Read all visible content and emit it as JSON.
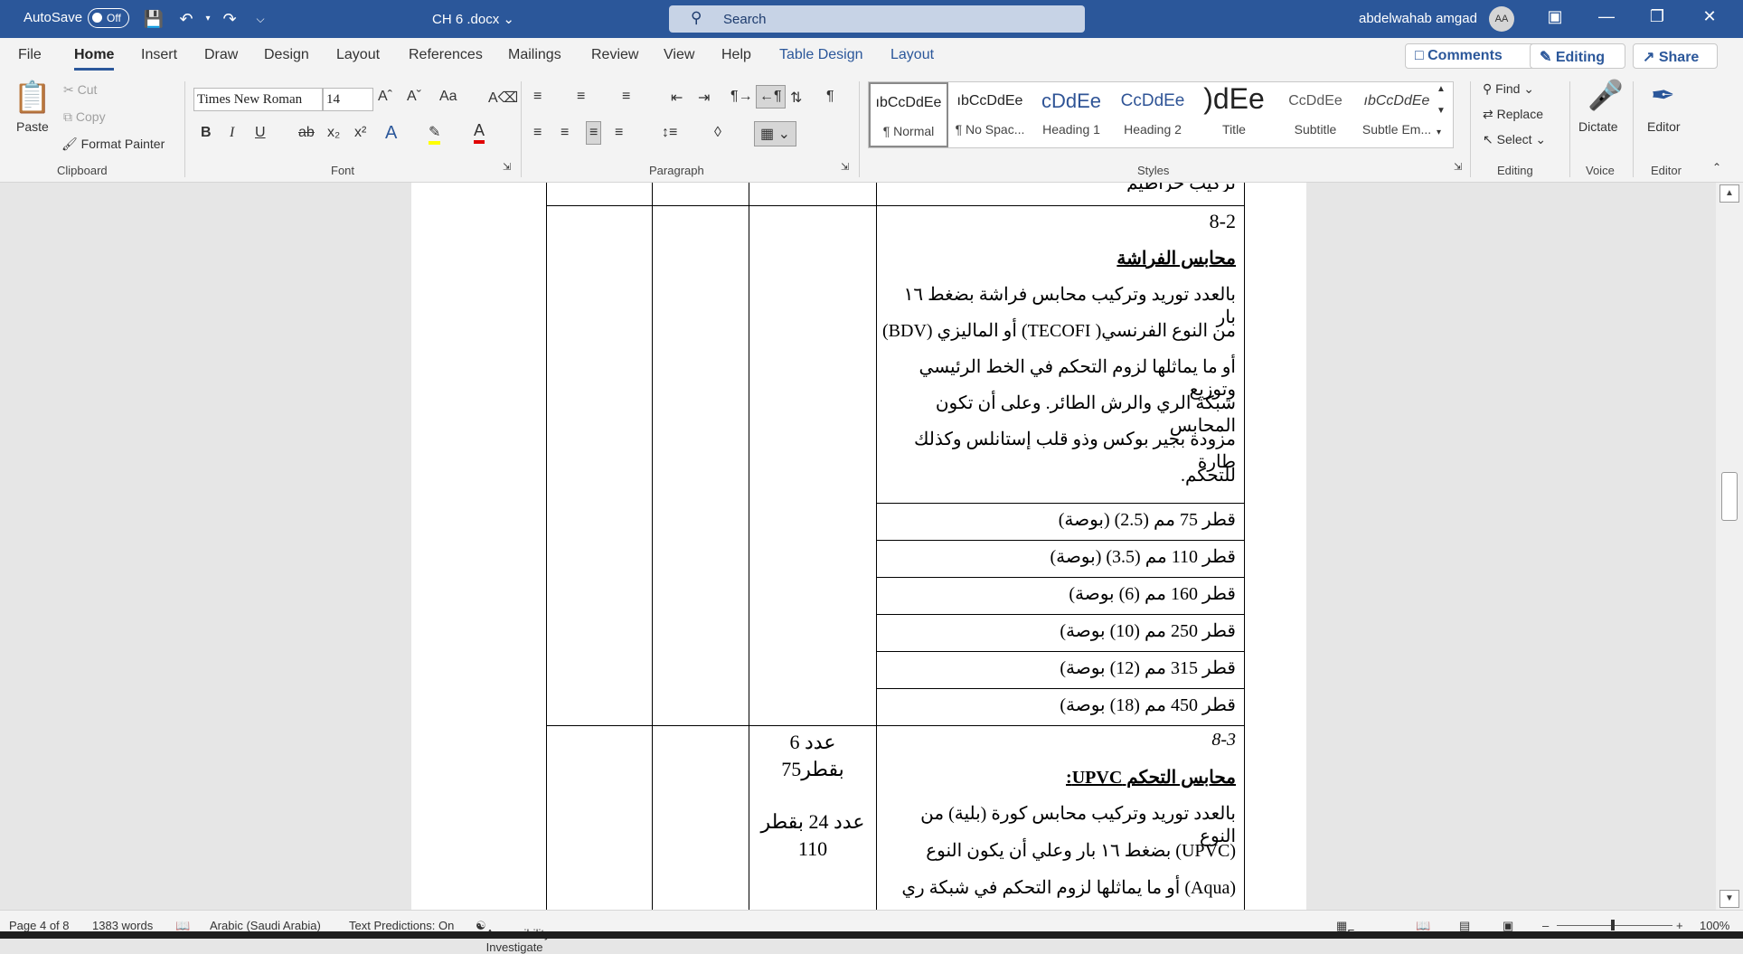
{
  "titlebar": {
    "autosave_label": "AutoSave",
    "autosave_state": "Off",
    "doc_name": "CH 6 .docx",
    "search_placeholder": "Search",
    "user_name": "abdelwahab amgad",
    "avatar_initials": "AA"
  },
  "tabs": [
    "File",
    "Home",
    "Insert",
    "Draw",
    "Design",
    "Layout",
    "References",
    "Mailings",
    "Review",
    "View",
    "Help",
    "Table Design",
    "Layout"
  ],
  "tab_buttons": {
    "comments": "Comments",
    "editing": "Editing",
    "share": "Share"
  },
  "clipboard": {
    "paste": "Paste",
    "cut": "Cut",
    "copy": "Copy",
    "format_painter": "Format Painter",
    "label": "Clipboard"
  },
  "font": {
    "name": "Times New Roman",
    "size": "14",
    "label": "Font"
  },
  "paragraph": {
    "label": "Paragraph"
  },
  "styles": {
    "label": "Styles",
    "items": [
      {
        "preview": "ıbCcDdEe",
        "name": "¶ Normal"
      },
      {
        "preview": "ıbCcDdEe",
        "name": "¶ No Spac..."
      },
      {
        "preview": "cDdEe",
        "name": "Heading 1"
      },
      {
        "preview": "CcDdEe",
        "name": "Heading 2"
      },
      {
        "preview": ")dEe",
        "name": "Title"
      },
      {
        "preview": "CcDdEe",
        "name": "Subtitle"
      },
      {
        "preview": "ıbCcDdEe",
        "name": "Subtle Em..."
      }
    ]
  },
  "editing": {
    "find": "Find",
    "replace": "Replace",
    "select": "Select",
    "label": "Editing"
  },
  "voice": {
    "dictate": "Dictate",
    "label": "Voice"
  },
  "editor_group": {
    "editor": "Editor",
    "label": "Editor"
  },
  "document": {
    "top_cut_text": "تركيب خراطيم",
    "section_82": {
      "number": "8-2",
      "heading": "محابس الفراشة",
      "lines": [
        "بالعدد توريد وتركيب محابس فراشة بضغط ١٦ بار",
        "من النوع الفرنسي( TECOFI) أو الماليزي (BDV)",
        "أو ما يماثلها لزوم التحكم في الخط الرئيسي وتوزيع",
        "شبكة الري والرش الطائر. وعلى أن تكون المحابس",
        "مزودة بجير بوكس وذو قلب إستانلس وكذلك طارة",
        "للتحكم."
      ],
      "rows": [
        "قطر 75 مم (2.5) (بوصة)",
        "قطر 110 مم (3.5) (بوصة)",
        "قطر 160 مم (6) بوصة)",
        "قطر 250 مم (10) بوصة)",
        "قطر 315 مم (12) بوصة)",
        "قطر 450 مم (18) بوصة)"
      ]
    },
    "section_83": {
      "number": "8-3",
      "heading": "محابس التحكم UPVC:",
      "lines": [
        "بالعدد توريد وتركيب محابس كورة (بلية) من النوع",
        "(UPVC) بضغط ١٦ بار وعلي أن يكون النوع",
        "(Aqua) أو ما يماثلها لزوم التحكم في شبكة ري"
      ],
      "qty_lines": [
        "عدد 6",
        "بقطر75",
        "عدد 24 بقطر",
        "110"
      ]
    }
  },
  "status": {
    "page": "Page 4 of 8",
    "words": "1383 words",
    "language": "Arabic (Saudi Arabia)",
    "predictions": "Text Predictions: On",
    "accessibility": "Accessibility: Investigate",
    "focus": "Focus",
    "zoom": "100%"
  }
}
